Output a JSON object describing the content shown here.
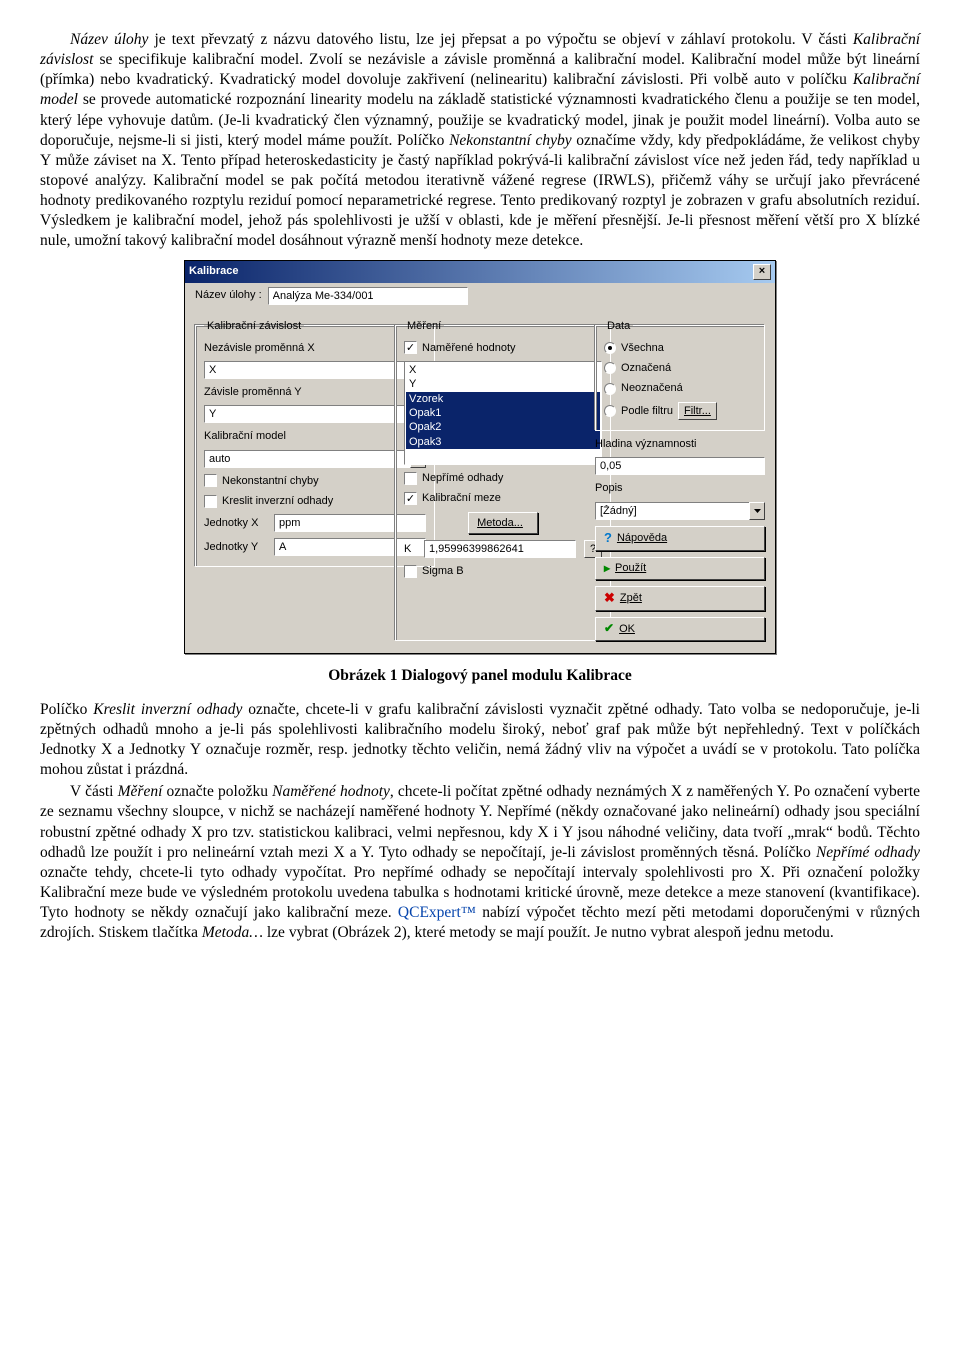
{
  "para1_runs": {
    "r1": "Název úlohy",
    "r2": " je text převzatý z názvu datového listu, lze jej přepsat a po výpočtu se objeví v záhlaví protokolu. V části ",
    "r3": "Kalibrační závislost",
    "r4": " se specifikuje kalibrační model. Zvolí se nezávisle a závisle proměnná a kalibrační model. Kalibrační model může být lineární (přímka) nebo kvadratický. Kvadratický model dovoluje zakřivení (nelinearitu) kalibrační závislosti. Při volbě auto v políčku ",
    "r5": "Kalibrační model",
    "r6": " se provede automatické rozpoznání linearity modelu na základě statistické významnosti kvadratického členu a použije se ten model, který lépe vyhovuje datům. (Je-li kvadratický člen významný, použije se kvadratický model, jinak je použit model lineární). Volba auto se doporučuje, nejsme-li si jisti, který model máme použít. Políčko ",
    "r7": "Nekonstantní chyby",
    "r8": " označíme vždy, kdy předpokládáme, že velikost chyby Y může záviset na X. Tento případ heteroskedasticity je častý například pokrývá-li kalibrační závislost více než jeden řád, tedy například u stopové analýzy. Kalibrační model se pak počítá metodou iterativně vážené regrese (IRWLS), přičemž váhy se určují jako převrácené hodnoty predikovaného rozptylu reziduí pomocí neparametrické regrese. Tento predikovaný rozptyl je zobrazen v grafu absolutních reziduí. Výsledkem je kalibrační model, jehož pás spolehlivosti je užší v oblasti, kde je měření přesnější. Je-li přesnost měření větší pro X blízké nule, umožní takový kalibrační model dosáhnout výrazně menší hodnoty meze detekce."
  },
  "figcap": "Obrázek 1 Dialogový panel modulu Kalibrace",
  "para2_runs": {
    "r1": "Políčko ",
    "r2": "Kreslit inverzní odhady",
    "r3": " označte, chcete-li v grafu kalibrační závislosti vyznačit zpětné odhady. Tato volba se nedoporučuje, je-li zpětných odhadů mnoho a je-li pás spolehlivosti kalibračního modelu široký, neboť graf pak může být nepřehledný. Text v políčkách Jednotky X a Jednotky Y označuje rozměr, resp. jednotky těchto veličin, nemá žádný vliv na výpočet a uvádí se v protokolu. Tato políčka mohou zůstat i prázdná."
  },
  "para3_runs": {
    "r1": "V části ",
    "r2": "Měření",
    "r3": " označte položku ",
    "r4": "Naměřené hodnoty",
    "r5": ", chcete-li počítat zpětné odhady neznámých X z naměřených Y. Po označení vyberte ze seznamu všechny sloupce, v nichž se nacházejí naměřené hodnoty Y. Nepřímé (někdy označované jako nelineární) odhady jsou speciální robustní zpětné odhady X pro tzv. statistickou kalibraci, velmi nepřesnou, kdy X i Y jsou náhodné veličiny, data tvoří „mrak“ bodů. Těchto odhadů lze použít i pro nelineární vztah mezi X a Y. Tyto odhady se nepočítají, je-li závislost proměnných těsná. Políčko ",
    "r6": "Nepřímé odhady",
    "r7": " označte tehdy, chcete-li tyto odhady vypočítat. Pro nepřímé odhady se nepočítají intervaly spolehlivosti pro X. Při označení položky Kalibrační meze bude ve výsledném protokolu uvedena tabulka s hodnotami kritické úrovně, meze detekce a meze stanovení (kvantifikace). Tyto hodnoty se někdy označují jako kalibrační meze. ",
    "r8": "QCExpert™",
    "r9": " nabízí výpočet těchto mezí pěti metodami doporučenými v různých zdrojích. Stiskem tlačítka ",
    "r10": "Metoda…",
    "r11": " lze vybrat (Obrázek 2), které metody se mají použít. Je nutno vybrat alespoň jednu metodu."
  },
  "dialog": {
    "title": "Kalibrace",
    "task_label": "Název úlohy :",
    "task_value": "Analýza Me-334/001",
    "group_kal": {
      "legend": "Kalibrační závislost",
      "x_label": "Nezávisle proměnná X",
      "x_value": "X",
      "y_label": "Závisle proměnná Y",
      "y_value": "Y",
      "model_label": "Kalibrační model",
      "model_value": "auto",
      "chk_nekonst": "Nekonstantní chyby",
      "chk_kreslit": "Kreslit inverzní odhady",
      "ux_label": "Jednotky X",
      "ux_value": "ppm",
      "uy_label": "Jednotky Y",
      "uy_value": "A"
    },
    "group_mer": {
      "legend": "Měření",
      "chk_namerene": "Naměřené hodnoty",
      "list": [
        "X",
        "Y",
        "Vzorek",
        "Opak1",
        "Opak2",
        "Opak3"
      ],
      "chk_neprime": "Nepřímé odhady",
      "chk_kalmeze": "Kalibrační meze",
      "btn_metoda": "Metoda...",
      "k_label": "K",
      "k_value": "1,95996399862641",
      "k_help": "?",
      "chk_sigmab": "Sigma B"
    },
    "group_data": {
      "legend": "Data",
      "r_all": "Všechna",
      "r_marked": "Označená",
      "r_unmarked": "Neoznačená",
      "r_filter": "Podle filtru",
      "btn_filter": "Filtr..."
    },
    "sig_label": "Hladina významnosti",
    "sig_value": "0,05",
    "desc_label": "Popis",
    "desc_value": "[Žádný]",
    "btn_help": "Nápověda",
    "btn_use": "Použít",
    "btn_back": "Zpět",
    "btn_ok": "OK"
  }
}
